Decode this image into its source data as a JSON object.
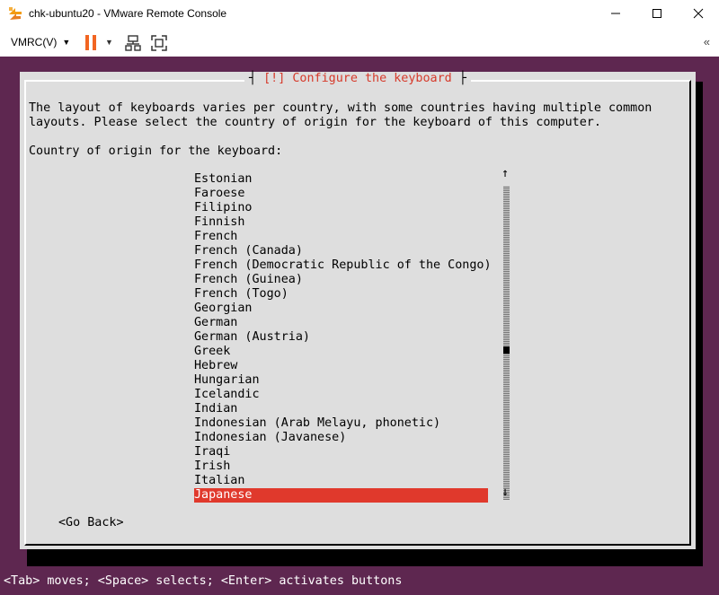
{
  "window": {
    "title": "chk-ubuntu20 - VMware Remote Console",
    "minimize_icon": "minimize-icon",
    "maximize_icon": "maximize-icon",
    "close_icon": "close-icon"
  },
  "toolbar": {
    "menu_label": "VMRC(V)",
    "accent_color": "#f26522"
  },
  "dialog": {
    "title_prefix": "[!]",
    "title": "Configure the keyboard",
    "intro_line1": "The layout of keyboards varies per country, with some countries having multiple common",
    "intro_line2": "layouts. Please select the country of origin for the keyboard of this computer.",
    "prompt": "Country of origin for the keyboard:",
    "items": [
      "Estonian",
      "Faroese",
      "Filipino",
      "Finnish",
      "French",
      "French (Canada)",
      "French (Democratic Republic of the Congo)",
      "French (Guinea)",
      "French (Togo)",
      "Georgian",
      "German",
      "German (Austria)",
      "Greek",
      "Hebrew",
      "Hungarian",
      "Icelandic",
      "Indian",
      "Indonesian (Arab Melayu, phonetic)",
      "Indonesian (Javanese)",
      "Iraqi",
      "Irish",
      "Italian",
      "Japanese"
    ],
    "selected": "Japanese",
    "scroll_up": "↑",
    "scroll_down": "↓",
    "go_back": "<Go Back>"
  },
  "status": "<Tab> moves; <Space> selects; <Enter> activates buttons",
  "colors": {
    "console_bg": "#5e2750",
    "dialog_bg": "#dedede",
    "highlight": "#e0392c",
    "title_text": "#d63a2b"
  }
}
